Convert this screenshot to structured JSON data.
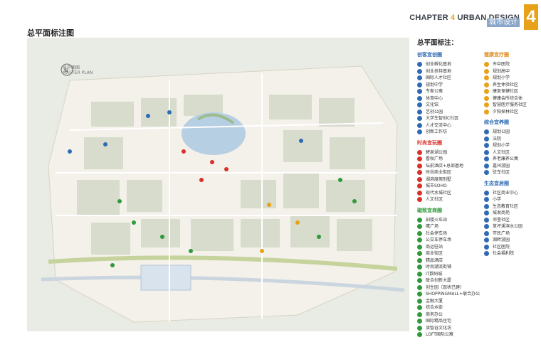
{
  "header": {
    "chapter_text": "CHAPTER",
    "chapter_num": "4",
    "chapter_rest": "URBAN DESIGN",
    "subtitle": "城市设计",
    "big_number": "4"
  },
  "page_title": "总平面标注图",
  "map": {
    "compass_label": "总平面图",
    "compass_sub": "MASTER PLAN"
  },
  "legend": {
    "title": "总平面标注：",
    "groups": [
      {
        "name": "创客宜创圈",
        "color": "#2e6bb5",
        "items": [
          "创业孵化基地",
          "创业扶持基地",
          "国际人才社区",
          "规划中学",
          "专家公寓",
          "体育中心",
          "文化馆",
          "艺创公园",
          "大学生智创C社区",
          "人才交流中心",
          "创新工作坊"
        ]
      },
      {
        "name": "时尚宜玩圈",
        "color": "#d9302a",
        "items": [
          "碧泉湖公园",
          "看秋广场",
          "坛前酒店+总部基地",
          "时尚商业街区",
          "湖滨度假别墅",
          "城市SOHO",
          "现代水城社区",
          "人文社区"
        ]
      },
      {
        "name": "磁致宜商圈",
        "color": "#2e9a3a",
        "items": [
          "刻楼火车站",
          "鹰广场",
          "社会停车场",
          "公交车停车场",
          "商运驻站",
          "商业街区",
          "精品酒店",
          "时尚潮流街铺",
          "IT数码城",
          "联合创新大厦",
          "创生园（现状已建）",
          "SHOPPINGMALL+联合办公",
          "金融大厦",
          "综合水街",
          "商务办公",
          "国际精品住宅",
          "读智谷文化坊",
          "LOFT国际公寓"
        ]
      },
      {
        "name": "健康宜疗圈",
        "color": "#e8a21a",
        "items": [
          "市中医院",
          "规划高中",
          "规划小学",
          "养生休验社区",
          "康复保健社区",
          "健康会所综合体",
          "智慧医疗服务社区",
          "夕阳探林社区"
        ]
      },
      {
        "name": "综合宜养圈",
        "color": "#2e6bb5",
        "items": [
          "规划公园",
          "法院",
          "规划小学",
          "人文社区",
          "养老康养公寓",
          "嘉州游园",
          "驻车社区"
        ]
      },
      {
        "name": "生态宜居圈",
        "color": "#2e6bb5",
        "items": [
          "社区商业中心",
          "小学",
          "生态教育社区",
          "城发商苑",
          "邻里社区",
          "草坪溪滨水公园",
          "市民广场",
          "湖畔游园",
          "社区医院",
          "社会福利院"
        ]
      }
    ]
  }
}
